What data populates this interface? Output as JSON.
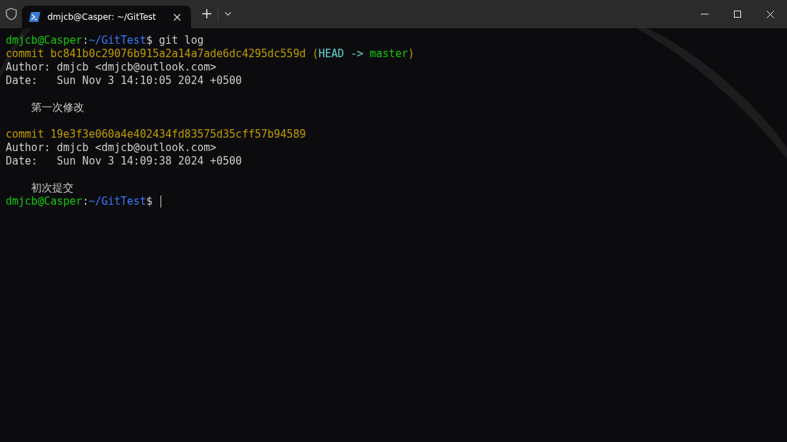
{
  "window": {
    "tab": {
      "title": "dmjcb@Casper: ~/GitTest",
      "selected": true
    }
  },
  "terminal": {
    "lines": [
      {
        "kind": "text",
        "segments": [
          {
            "text": "dmjcb@Casper",
            "kind": "user"
          },
          {
            "text": ":",
            "kind": "plain"
          },
          {
            "text": "~/GitTest",
            "kind": "path"
          },
          {
            "text": "$ git log",
            "kind": "plain"
          }
        ]
      },
      {
        "kind": "text",
        "segments": [
          {
            "text": "commit bc841b0c29076b915a2a14a7ade6dc4295dc559d (",
            "kind": "commit"
          },
          {
            "text": "HEAD -> ",
            "kind": "head"
          },
          {
            "text": "master",
            "kind": "branch"
          },
          {
            "text": ")",
            "kind": "commit"
          }
        ]
      },
      {
        "kind": "text",
        "segments": [
          {
            "text": "Author: dmjcb <dmjcb@outlook.com>",
            "kind": "plain"
          }
        ]
      },
      {
        "kind": "text",
        "segments": [
          {
            "text": "Date:   Sun Nov 3 14:10:05 2024 +0500",
            "kind": "plain"
          }
        ]
      },
      {
        "kind": "blank"
      },
      {
        "kind": "text",
        "segments": [
          {
            "text": "    第一次修改",
            "kind": "plain"
          }
        ]
      },
      {
        "kind": "blank"
      },
      {
        "kind": "text",
        "segments": [
          {
            "text": "commit 19e3f3e060a4e402434fd83575d35cff57b94589",
            "kind": "commit"
          }
        ]
      },
      {
        "kind": "text",
        "segments": [
          {
            "text": "Author: dmjcb <dmjcb@outlook.com>",
            "kind": "plain"
          }
        ]
      },
      {
        "kind": "text",
        "segments": [
          {
            "text": "Date:   Sun Nov 3 14:09:38 2024 +0500",
            "kind": "plain"
          }
        ]
      },
      {
        "kind": "blank"
      },
      {
        "kind": "text",
        "segments": [
          {
            "text": "    初次提交",
            "kind": "plain"
          }
        ]
      },
      {
        "kind": "text",
        "cursor": true,
        "segments": [
          {
            "text": "dmjcb@Casper",
            "kind": "user"
          },
          {
            "text": ":",
            "kind": "plain"
          },
          {
            "text": "~/GitTest",
            "kind": "path"
          },
          {
            "text": "$ ",
            "kind": "plain"
          }
        ]
      }
    ]
  }
}
